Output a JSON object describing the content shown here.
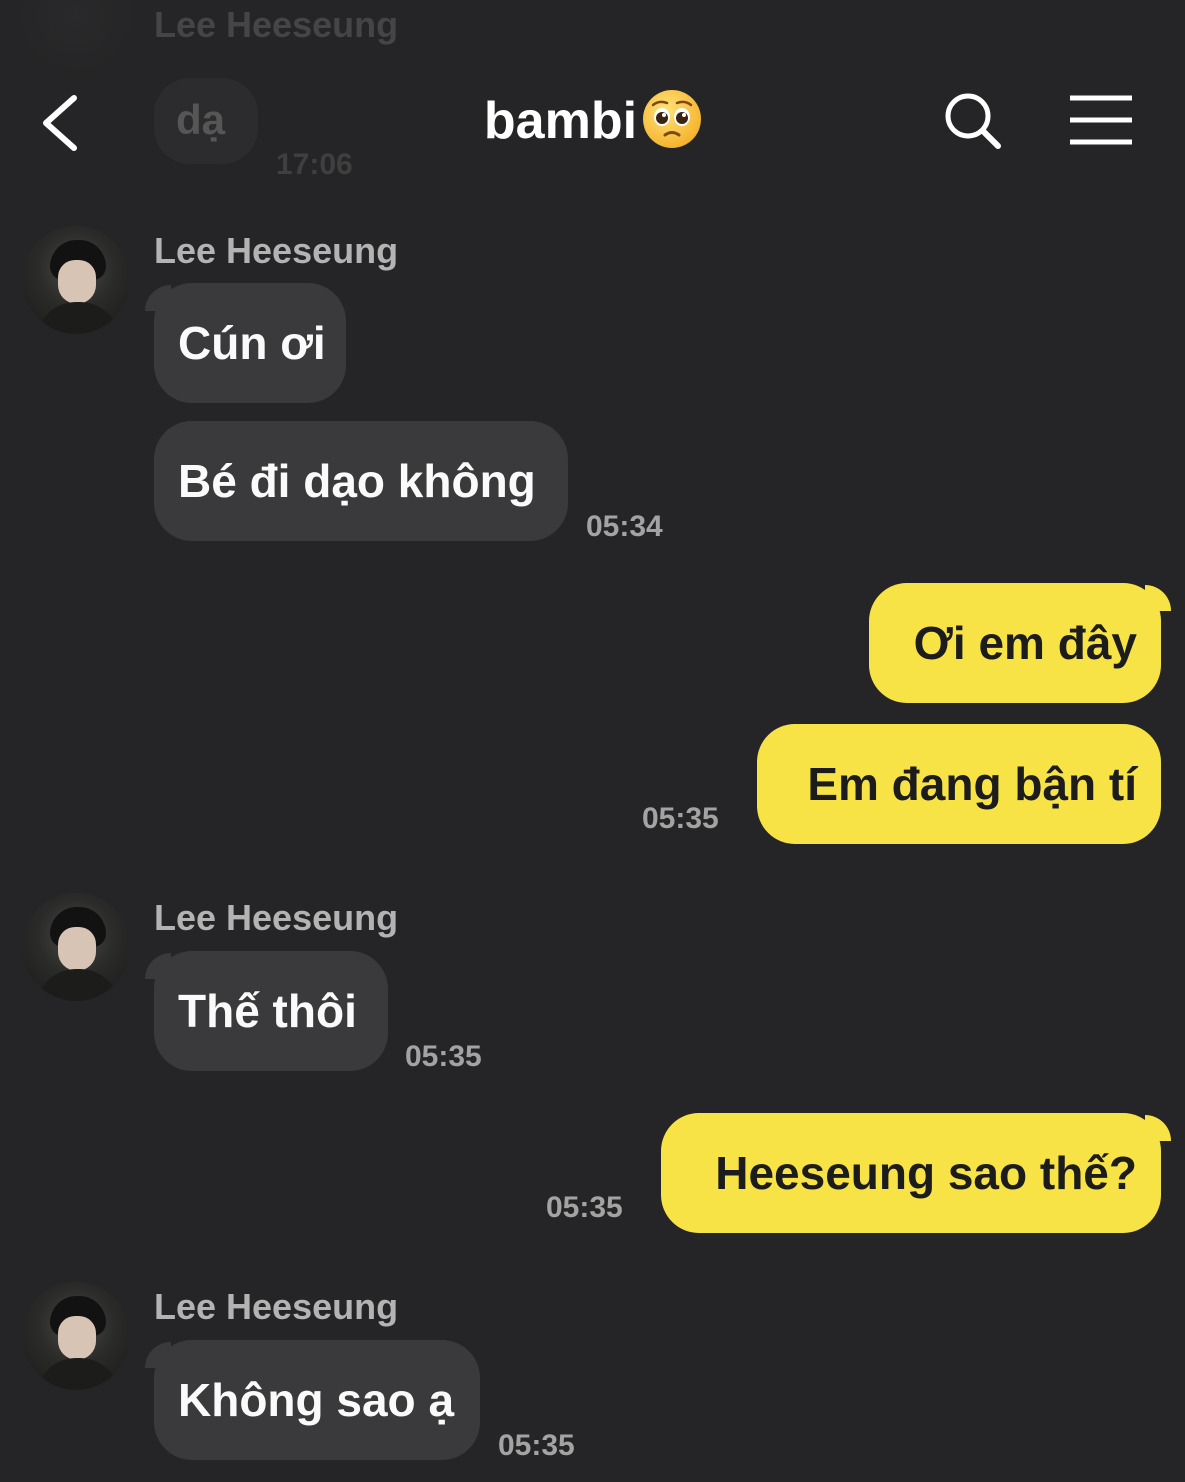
{
  "header": {
    "title": "bambi",
    "title_emoji": "pleading-face-emoji",
    "back_icon": "chevron-left-icon",
    "search_icon": "search-icon",
    "menu_icon": "hamburger-menu-icon"
  },
  "previous_message": {
    "sender": "Lee Heeseung",
    "text": "dạ",
    "time": "17:06"
  },
  "messages": [
    {
      "direction": "in",
      "sender": "Lee Heeseung",
      "text": "Cún ơi"
    },
    {
      "direction": "in",
      "text": "Bé đi dạo không",
      "time": "05:34"
    },
    {
      "direction": "out",
      "text": "Ơi em đây"
    },
    {
      "direction": "out",
      "text": "Em đang bận tí",
      "time": "05:35"
    },
    {
      "direction": "in",
      "sender": "Lee Heeseung",
      "text": "Thế thôi",
      "time": "05:35"
    },
    {
      "direction": "out",
      "text": "Heeseung sao thế?",
      "time": "05:35"
    },
    {
      "direction": "in",
      "sender": "Lee Heeseung",
      "text": "Không sao ạ",
      "time": "05:35"
    }
  ],
  "colors": {
    "background": "#252527",
    "incoming_bubble": "#3a3a3c",
    "outgoing_bubble": "#f8e346"
  }
}
